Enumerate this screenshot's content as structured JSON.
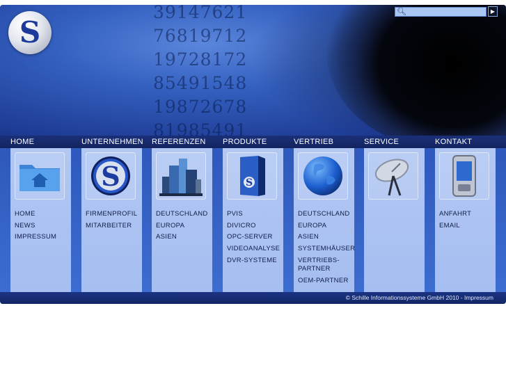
{
  "search": {
    "placeholder": "",
    "icon": "magnifier-icon",
    "go_icon": "arrow-right-icon"
  },
  "logo": {
    "letter": "S"
  },
  "header": {
    "numbers": [
      "39147621",
      "76819712",
      "19728172",
      "85491548",
      "19872678",
      "81985491"
    ]
  },
  "nav": [
    "HOME",
    "UNTERNEHMEN",
    "REFERENZEN",
    "PRODUKTE",
    "VERTRIEB",
    "SERVICE",
    "KONTAKT"
  ],
  "columns": [
    {
      "icon": "home-folder-icon",
      "links": [
        "HOME",
        "NEWS",
        "IMPRESSUM"
      ]
    },
    {
      "icon": "company-logo-icon",
      "links": [
        "FIRMENPROFIL",
        "MITARBEITER"
      ]
    },
    {
      "icon": "buildings-icon",
      "links": [
        "DEUTSCHLAND",
        "EUROPA",
        "ASIEN"
      ]
    },
    {
      "icon": "software-box-icon",
      "links": [
        "PVIS",
        "DIVICRO",
        "OPC-SERVER",
        "VIDEOANALYSE",
        "DVR-SYSTEME"
      ]
    },
    {
      "icon": "globe-icon",
      "links": [
        "DEUTSCHLAND",
        "EUROPA",
        "ASIEN",
        "SYSTEMHÄUSER",
        "VERTRIEBS-PARTNER",
        "OEM-PARTNER"
      ]
    },
    {
      "icon": "satellite-dish-icon",
      "links": []
    },
    {
      "icon": "pda-phone-icon",
      "links": [
        "ANFAHRT",
        "EMAIL"
      ]
    }
  ],
  "footer": {
    "text": "© Schille Informationssysteme GmbH 2010 - Impressum"
  },
  "colors": {
    "bar": "#13245f",
    "column": "#b0c7f3",
    "background": "#2c55b8"
  }
}
